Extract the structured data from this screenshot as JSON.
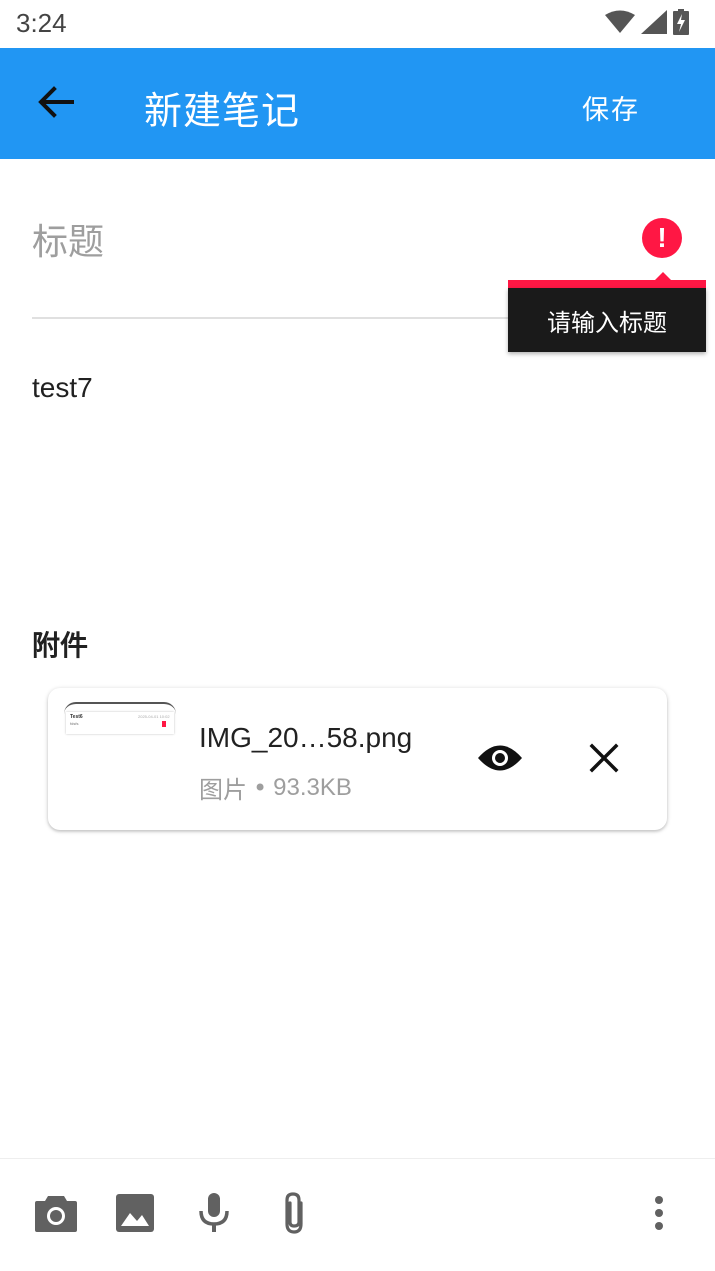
{
  "status_bar": {
    "time": "3:24",
    "icons": [
      "wifi-icon",
      "signal-icon",
      "battery-charging-icon"
    ]
  },
  "app_bar": {
    "back_icon": "arrow-back-icon",
    "title": "新建笔记",
    "save_label": "保存",
    "color": "#2196F3"
  },
  "note": {
    "title_placeholder": "标题",
    "title_value": "",
    "title_error": "请输入标题",
    "content": "test7"
  },
  "attachments": {
    "header": "附件",
    "items": [
      {
        "file_name": "IMG_20…58.png",
        "type": "图片",
        "separator": "•",
        "size": "93.3KB",
        "thumbnail": {
          "title": "Test6",
          "subtitle": "fdsfs",
          "date": "2025-04-01 10:02"
        }
      }
    ]
  },
  "bottom_toolbar": {
    "buttons": [
      "camera-icon",
      "image-icon",
      "mic-icon",
      "attach-icon",
      "more-vert-icon"
    ]
  },
  "colors": {
    "error": "#FF1744",
    "popup_background": "#1A1A1A",
    "hint_text": "#9E9E9E"
  }
}
